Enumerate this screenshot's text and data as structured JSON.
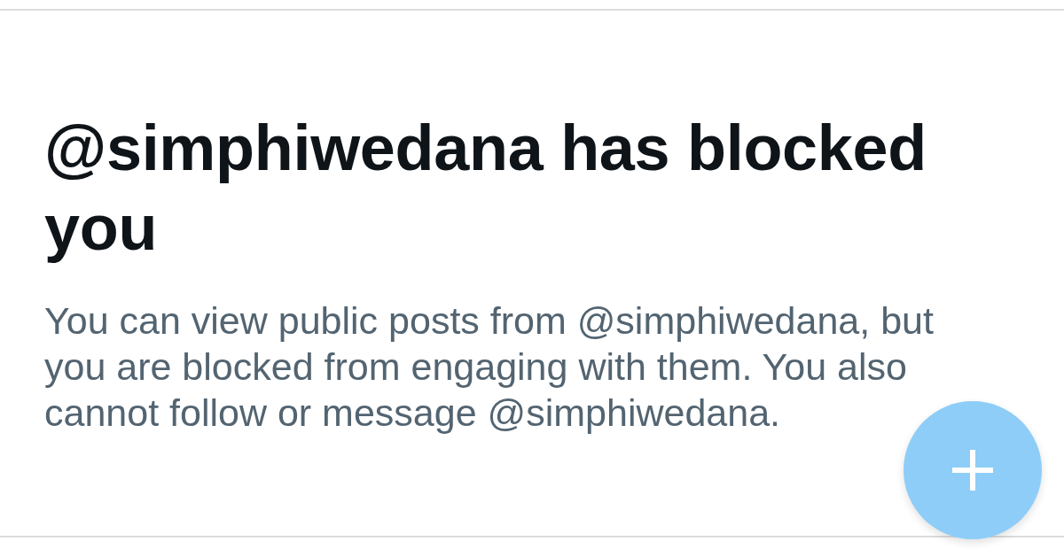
{
  "heading": "@simphiwedana has blocked you",
  "message": "You can view public posts from @simphiwedana, but you are blocked from engaging with them. You also cannot follow or message @simphiwedana."
}
